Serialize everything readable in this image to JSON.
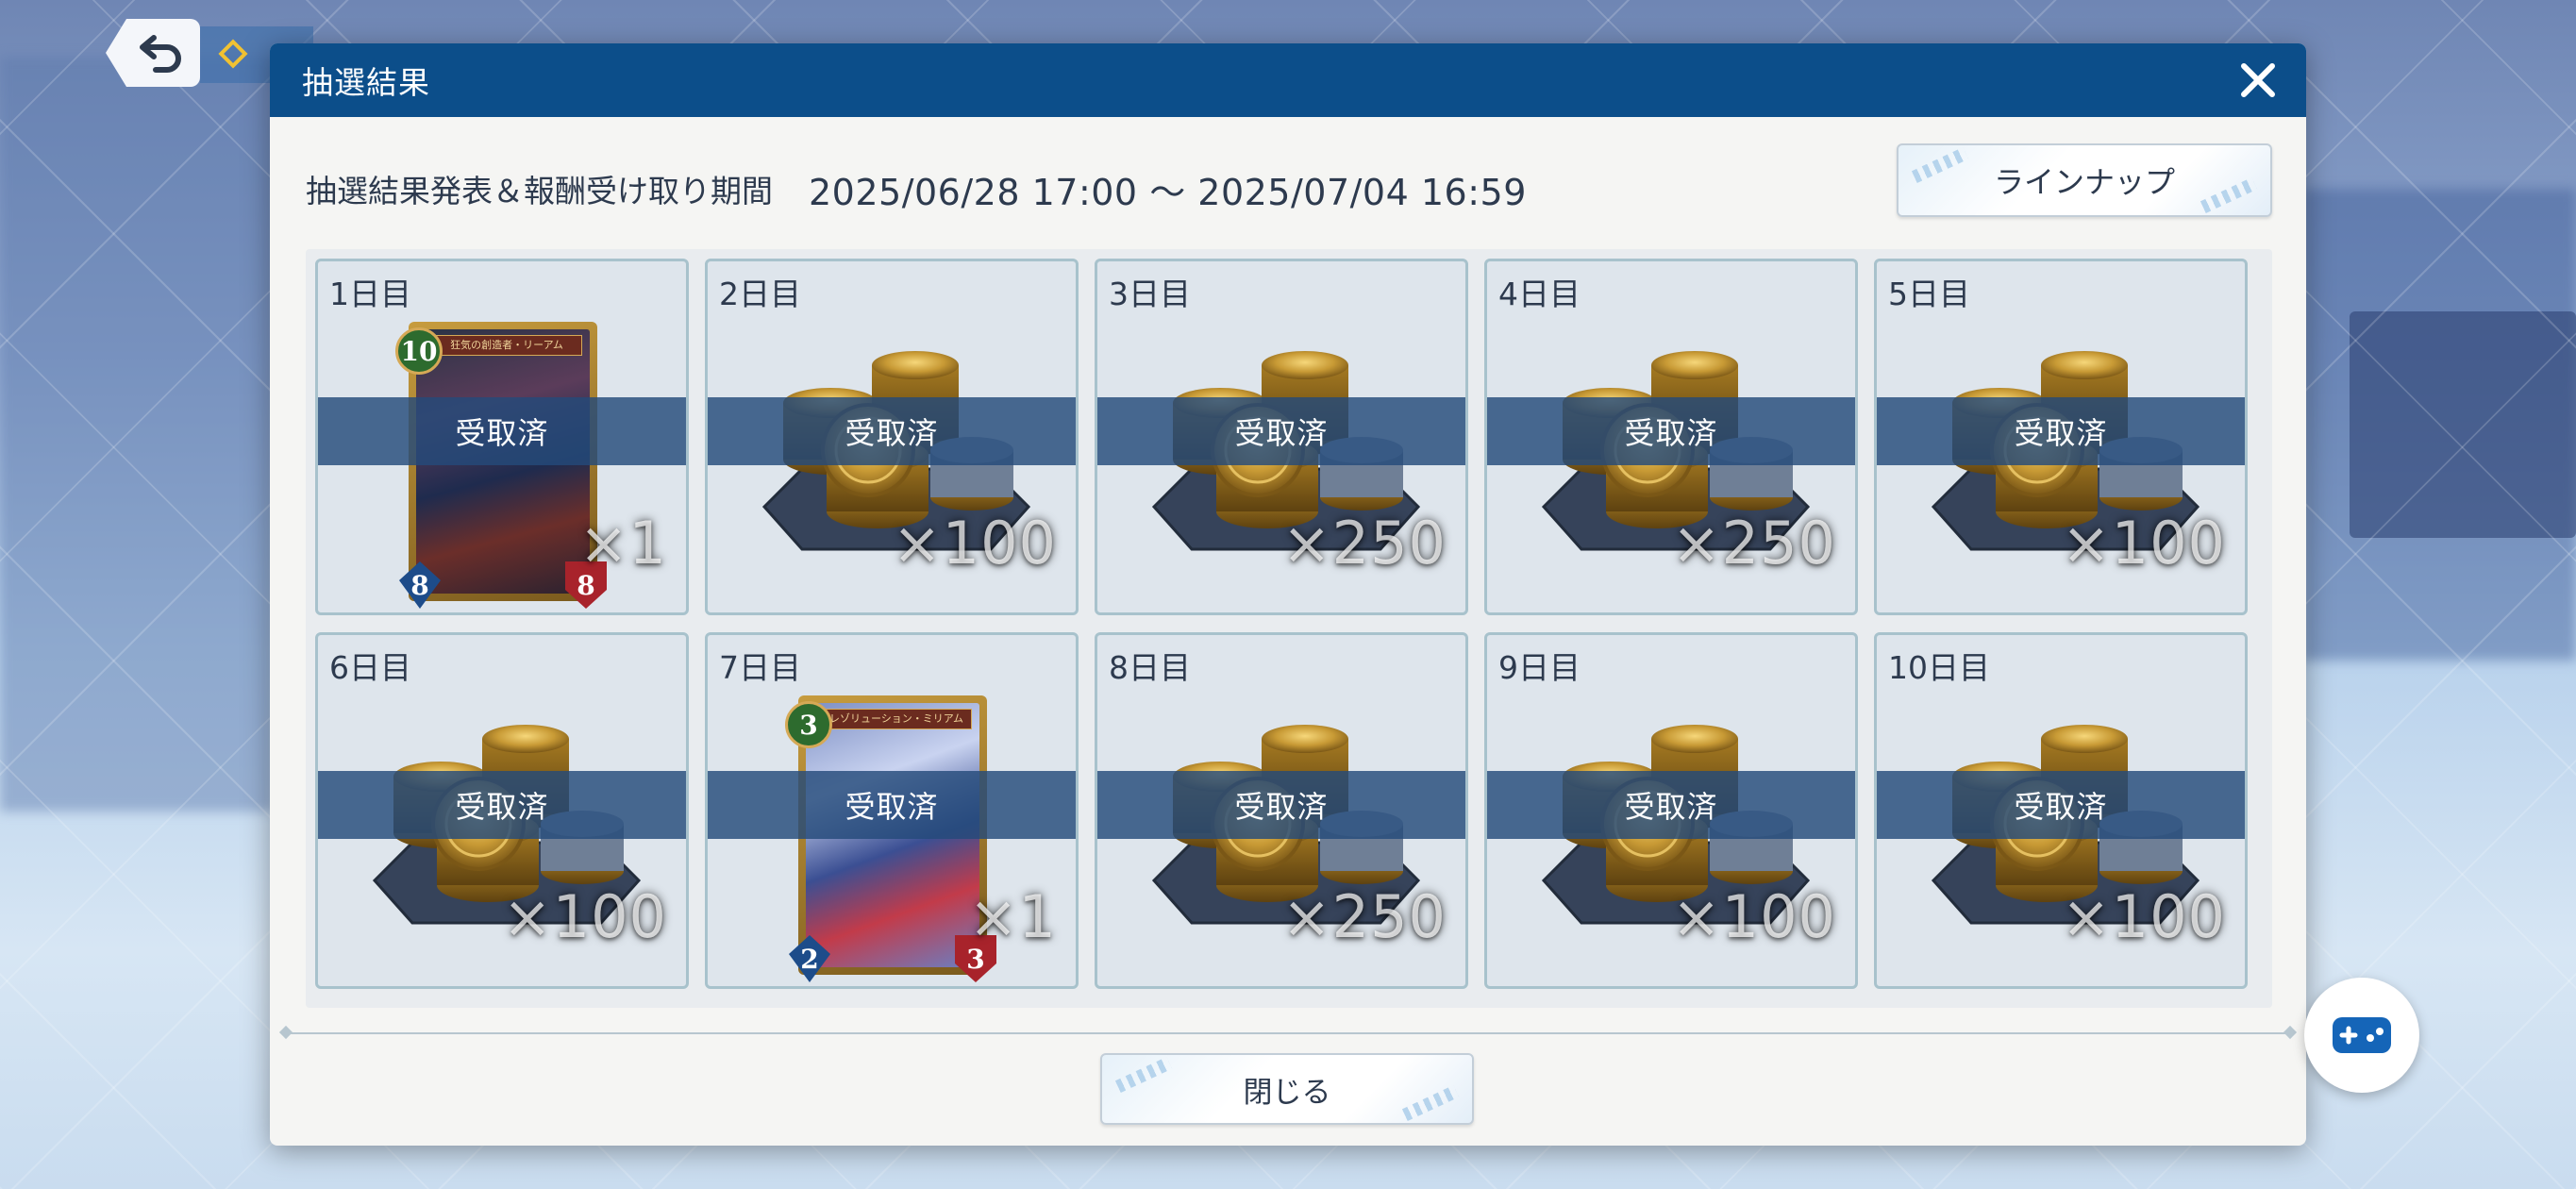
{
  "dialog": {
    "title": "抽選結果",
    "period_label": "抽選結果発表＆報酬受け取り期間",
    "period_value": "2025/06/28 17:00 ～ 2025/07/04 16:59",
    "lineup_label": "ラインナップ",
    "close_label": "閉じる",
    "claimed_label": "受取済"
  },
  "rewards": [
    {
      "day": "1日目",
      "type": "card",
      "quantity": "×1",
      "card": {
        "name": "狂気の創造者・リーアム",
        "cost": "10",
        "attack": "8",
        "defense": "8"
      }
    },
    {
      "day": "2日目",
      "type": "coins",
      "quantity": "×100"
    },
    {
      "day": "3日目",
      "type": "coins",
      "quantity": "×250"
    },
    {
      "day": "4日目",
      "type": "coins",
      "quantity": "×250"
    },
    {
      "day": "5日目",
      "type": "coins",
      "quantity": "×100"
    },
    {
      "day": "6日目",
      "type": "coins",
      "quantity": "×100"
    },
    {
      "day": "7日目",
      "type": "card",
      "quantity": "×1",
      "card": {
        "name": "レゾリューション・ミリアム",
        "cost": "3",
        "attack": "2",
        "defense": "3"
      }
    },
    {
      "day": "8日目",
      "type": "coins",
      "quantity": "×250"
    },
    {
      "day": "9日目",
      "type": "coins",
      "quantity": "×100"
    },
    {
      "day": "10日目",
      "type": "coins",
      "quantity": "×100"
    }
  ],
  "icons": {
    "back": "back-arrow-icon",
    "close": "close-icon",
    "gamepad": "gamepad-icon",
    "coins": "coin-pile-icon"
  },
  "colors": {
    "header": "#0c4e8a",
    "claimed_band": "#244a7a",
    "dialog_bg": "#f5f5f3"
  }
}
